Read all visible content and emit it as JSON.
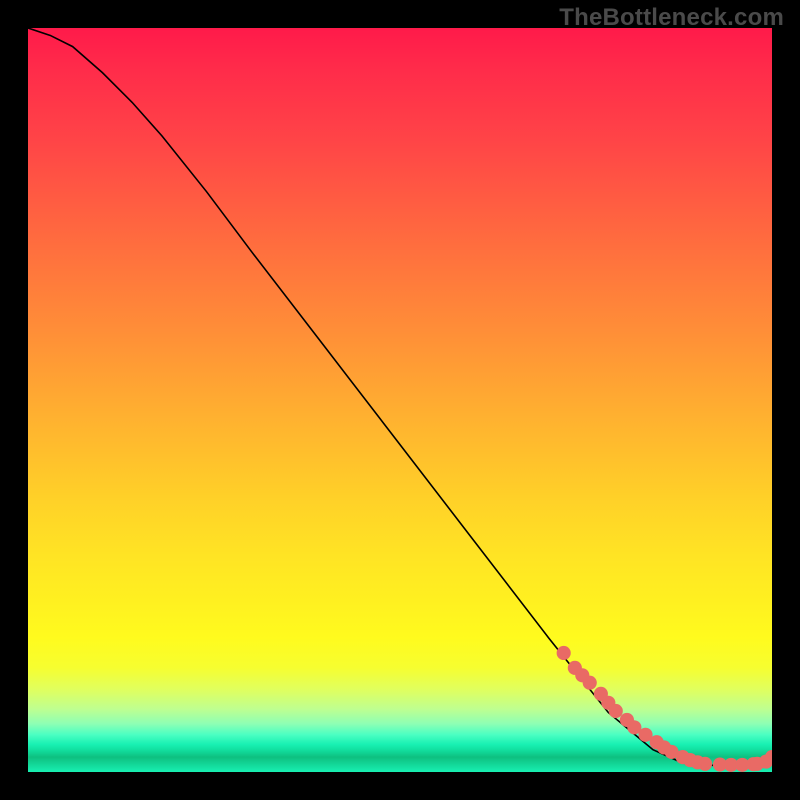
{
  "watermark": "TheBottleneck.com",
  "chart_data": {
    "type": "line",
    "title": "",
    "xlabel": "",
    "ylabel": "",
    "xlim": [
      0,
      100
    ],
    "ylim": [
      0,
      100
    ],
    "grid": false,
    "series": [
      {
        "name": "curve",
        "style": "line",
        "color": "#000000",
        "x": [
          0,
          3,
          6,
          10,
          14,
          18,
          24,
          30,
          40,
          50,
          60,
          70,
          78,
          84,
          88,
          90,
          92,
          94,
          96,
          98,
          100
        ],
        "y": [
          100,
          99,
          97.5,
          94,
          90,
          85.5,
          78,
          70,
          57,
          44,
          31,
          18,
          8,
          3,
          1.2,
          1,
          0.9,
          0.9,
          1,
          1.3,
          2
        ]
      },
      {
        "name": "highlight-points",
        "style": "dots",
        "color": "#e96a65",
        "x": [
          72,
          73.5,
          74.5,
          75.5,
          77,
          78,
          79,
          80.5,
          81.5,
          83,
          84.5,
          85.5,
          86.5,
          88,
          89,
          90,
          91,
          93,
          94.5,
          96,
          97.5,
          98,
          99.2,
          100
        ],
        "y": [
          16,
          14,
          13,
          12,
          10.5,
          9.3,
          8.2,
          7,
          6,
          5,
          4,
          3.3,
          2.7,
          2,
          1.6,
          1.3,
          1.1,
          1,
          0.95,
          0.95,
          1.05,
          1.1,
          1.4,
          2
        ]
      }
    ]
  }
}
